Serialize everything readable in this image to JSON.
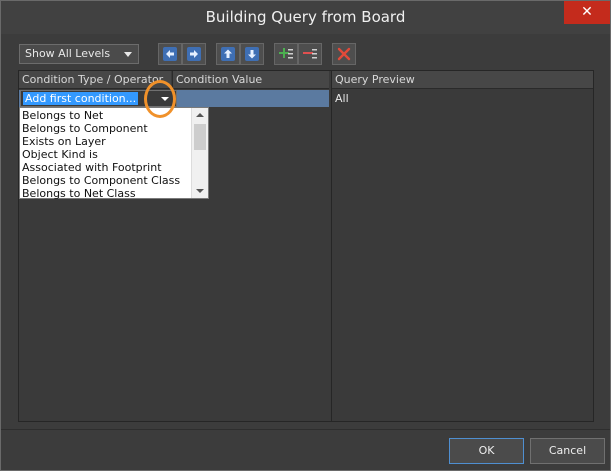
{
  "window": {
    "title": "Building Query from Board",
    "close_icon": "✕"
  },
  "toolbar": {
    "levels_value": "Show All Levels",
    "buttons": [
      {
        "icon": "arrow-left-icon"
      },
      {
        "icon": "arrow-right-icon"
      },
      {
        "icon": "arrow-up-icon"
      },
      {
        "icon": "arrow-down-icon"
      },
      {
        "icon": "add-condition-icon"
      },
      {
        "icon": "remove-condition-icon"
      },
      {
        "icon": "delete-icon"
      }
    ]
  },
  "left_pane": {
    "header_type": "Condition Type / Operator",
    "header_value": "Condition Value",
    "combo_value": "Add first condition..."
  },
  "dropdown": {
    "items": [
      "Belongs to Net",
      "Belongs to Component",
      "Exists on Layer",
      "Object Kind is",
      "Associated with Footprint",
      "Belongs to Component Class",
      "Belongs to Net Class"
    ]
  },
  "right_pane": {
    "header": "Query Preview",
    "preview": "All"
  },
  "footer": {
    "ok_label": "OK",
    "cancel_label": "Cancel"
  },
  "colors": {
    "accent": "#3399ff",
    "row_highlight": "#5b7aa0",
    "close": "#c42b1c",
    "annotation_ring": "#f0912a"
  }
}
